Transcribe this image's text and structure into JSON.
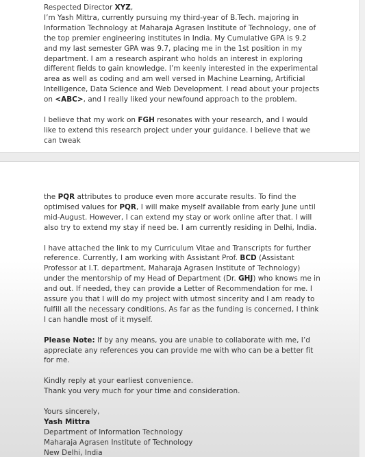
{
  "page1": {
    "salutation_prefix": "Respected Director ",
    "salutation_name": "XYZ",
    "salutation_suffix": ",",
    "intro_part1": "I’m Yash Mittra, currently pursuing my third-year of B.Tech. majoring in Information Technology at Maharaja Agrasen Institute of Technology, one of the top premier engineering institutes in India. My Cumulative GPA is 9.2 and my last semester GPA was 9.7, placing me in the 1st position in my department. I am a research aspirant who holds an interest in exploring different fields to gain knowledge. I’m keenly interested in the experimental area as well as coding and am well versed in Machine Learning, Artificial Intelligence, Data Science and Web Development. I read about your projects on ",
    "intro_bold": "<ABC>",
    "intro_part2": ", and I really liked your newfound approach to the problem.",
    "fgh_part1": "I believe that my work on ",
    "fgh_bold": "FGH",
    "fgh_part2": " resonates with your research, and I would like to extend this research project under your guidance. I believe that we can tweak"
  },
  "page2": {
    "pqr_part1": "the ",
    "pqr_bold1": "PQR",
    "pqr_part2": " attributes to produce even more accurate results. To find the optimised values for ",
    "pqr_bold2": "PQR",
    "pqr_part3": ", I will make myself available from early June until mid-August. However, I can extend my stay or work online after that. I will also try to extend my stay if need be. I am currently residing in Delhi, India.",
    "cv_part1": "I have attached the link to my Curriculum Vitae and Transcripts for further reference. Currently, I am working with Assistant Prof. ",
    "cv_bold1": "BCD",
    "cv_part2": " (Assistant Professor at I.T. department, Maharaja Agrasen Institute of Technology) under the mentorship of my Head of Department (Dr. ",
    "cv_bold2": "GHJ",
    "cv_part3": ") who knows me in and out. If needed, they can provide a Letter of Recommendation for me. I assure you that I will do my project with utmost sincerity and I am ready to fulfill all the necessary conditions. As far as the funding is concerned, I think I can handle most of it myself.",
    "note_bold": "Please Note:",
    "note_text": " If by any means, you are unable to collaborate with me, I’d appreciate any references you can provide me with who can be a better fit for me.",
    "reply_line": "Kindly reply at your earliest convenience.",
    "thanks_line": "Thank you very much for your time and consideration.",
    "closing": "Yours sincerely,",
    "sender_name": "Yash Mittra",
    "sender_dept": "Department of Information Technology",
    "sender_institute": "Maharaja Agrasen Institute of Technology",
    "sender_city": "New Delhi, India"
  }
}
